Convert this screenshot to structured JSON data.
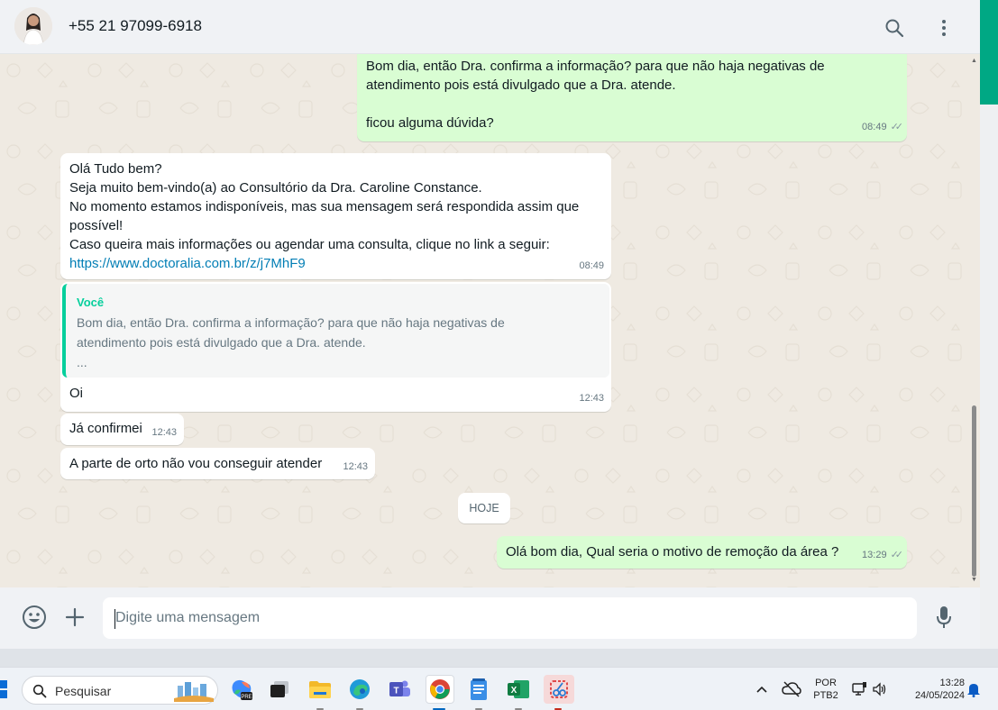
{
  "header": {
    "contact": "+55 21 97099-6918"
  },
  "messages": {
    "m1": {
      "text": "Bom dia, então Dra. confirma a informação? para que não haja negativas de\natendimento pois está divulgado que a Dra. atende.\n\nficou alguma dúvida?",
      "time": "08:49"
    },
    "m2": {
      "text": "Olá Tudo bem?\nSeja muito bem-vindo(a) ao Consultório da Dra. Caroline Constance.\nNo momento estamos indisponíveis, mas sua mensagem será respondida assim que\npossível!\nCaso queira mais informações ou agendar uma consulta, clique no link a seguir:",
      "link": "https://www.doctoralia.com.br/z/j7MhF9",
      "time": "08:49"
    },
    "m3": {
      "quote_author": "Você",
      "quote_text": "Bom dia, então Dra. confirma a informação? para que não haja negativas de\natendimento pois está divulgado que a Dra. atende.\n...",
      "text": "Oi",
      "time": "12:43"
    },
    "m4": {
      "text": "Já confirmei",
      "time": "12:43"
    },
    "m5": {
      "text": "A parte de orto não vou conseguir atender",
      "time": "12:43"
    },
    "date_chip": "HOJE",
    "m6": {
      "text": "Olá bom dia, Qual seria o motivo de remoção da área ?",
      "time": "13:29"
    }
  },
  "composer": {
    "placeholder": "Digite uma mensagem"
  },
  "taskbar": {
    "search_label": "Pesquisar",
    "lang_top": "POR",
    "lang_bottom": "PTB2",
    "time": "13:28",
    "date": "24/05/2024",
    "copilot_badge": "PRE"
  },
  "colors": {
    "accent": "#00a884",
    "outgoing_bubble": "#d9fdd3",
    "incoming_bubble": "#ffffff",
    "chat_bg": "#efeae2"
  }
}
